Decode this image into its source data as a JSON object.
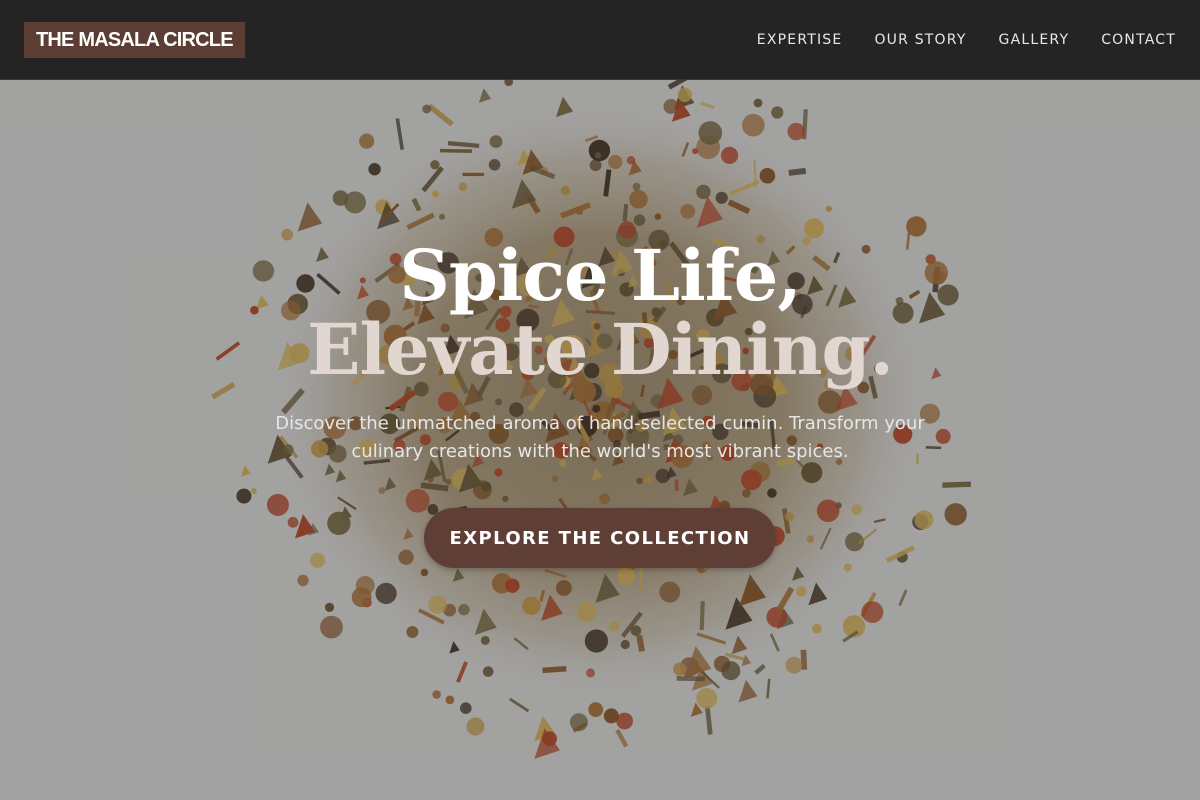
{
  "nav": {
    "brand": "THE MASALA CIRCLE",
    "links": [
      {
        "label": "EXPERTISE"
      },
      {
        "label": "OUR STORY"
      },
      {
        "label": "GALLERY"
      },
      {
        "label": "CONTACT"
      }
    ]
  },
  "hero": {
    "headline_line1": "Spice Life,",
    "headline_line2": "Elevate Dining.",
    "subtext": "Discover the unmatched aroma of hand-selected cumin. Transform your culinary creations with the world's most vibrant spices.",
    "cta_label": "EXPLORE THE COLLECTION",
    "background_image": "spice-blend-photo"
  },
  "colors": {
    "nav_background": "#202020",
    "brand_background": "#5b3d33",
    "cta_background": "#5f3f35",
    "headline_secondary": "#e2d6d1"
  }
}
